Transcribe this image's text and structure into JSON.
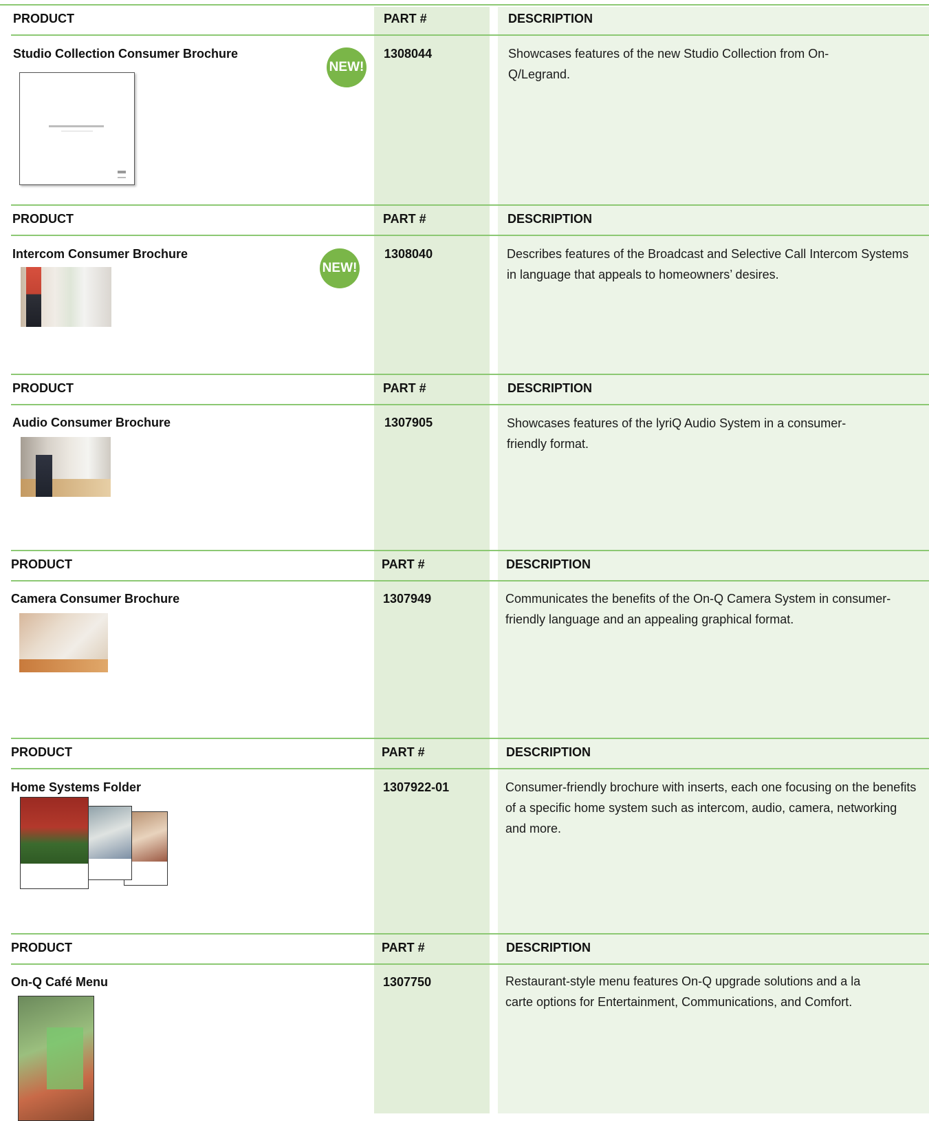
{
  "headers": {
    "product": "PRODUCT",
    "part": "PART #",
    "description": "DESCRIPTION"
  },
  "badge_label": "NEW!",
  "colors": {
    "rule": "#8cc873",
    "part_column": "#e2eed9",
    "description_column": "#ecf4e7",
    "badge": "#7ab648"
  },
  "items": [
    {
      "name": "Studio Collection Consumer Brochure",
      "part": "1308044",
      "description": "Showcases features of the new Studio Collection from On-Q/Legrand.",
      "is_new": true
    },
    {
      "name": "Intercom Consumer Brochure",
      "part": "1308040",
      "description": "Describes features of the Broadcast and Selective Call Intercom Systems in language that appeals to homeowners’ desires.",
      "is_new": true
    },
    {
      "name": "Audio Consumer Brochure",
      "part": "1307905",
      "description": "Showcases features of the lyriQ Audio System in a consumer-friendly format.",
      "is_new": false
    },
    {
      "name": "Camera Consumer Brochure",
      "part": "1307949",
      "description": "Communicates the benefits of the On-Q Camera System in consumer-friendly language and an appealing graphical format.",
      "is_new": false
    },
    {
      "name": "Home Systems Folder",
      "part": "1307922-01",
      "description": "Consumer-friendly brochure with inserts, each one focusing on the benefits of a specific home system such as intercom, audio, camera, networking and more.",
      "is_new": false
    },
    {
      "name": "On-Q Café Menu",
      "part": "1307750",
      "description": "Restaurant-style menu features On-Q upgrade solutions and a la carte options for Entertainment, Communications, and Comfort.",
      "is_new": false
    }
  ]
}
